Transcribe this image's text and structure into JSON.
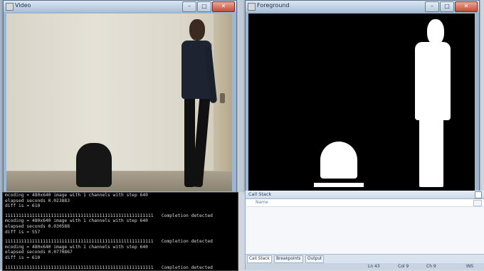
{
  "windows": {
    "video": {
      "title": "Video"
    },
    "foreground": {
      "title": "Foreground"
    }
  },
  "console": {
    "lines": [
      "mcoding = 480x640 image with 1 channels with step 640",
      "elapsed seconds 0.023883",
      "diff is = 610",
      "",
      "1111111111111111111111111111111111111111111111111111111   Completion detected",
      "mcoding = 480x640 image with 1 channels with step 640",
      "elapsed seconds 0.030588",
      "diff is = 557",
      "",
      "1111111111111111111111111111111111111111111111111111111   Completion detected",
      "mcoding = 480x640 image with 1 channels with step 640",
      "elapsed seconds 0.0770867",
      "diff is = 610",
      "",
      "1111111111111111111111111111111111111111111111111111111   Completion detected"
    ]
  },
  "ide": {
    "panel_title": "Call Stack",
    "column_name": "Name",
    "tabs": [
      "Call Stack",
      "Breakpoints",
      "Output"
    ],
    "status": {
      "ln": "Ln 43",
      "col": "Col 9",
      "ch": "Ch 9",
      "mode": "INS"
    }
  }
}
